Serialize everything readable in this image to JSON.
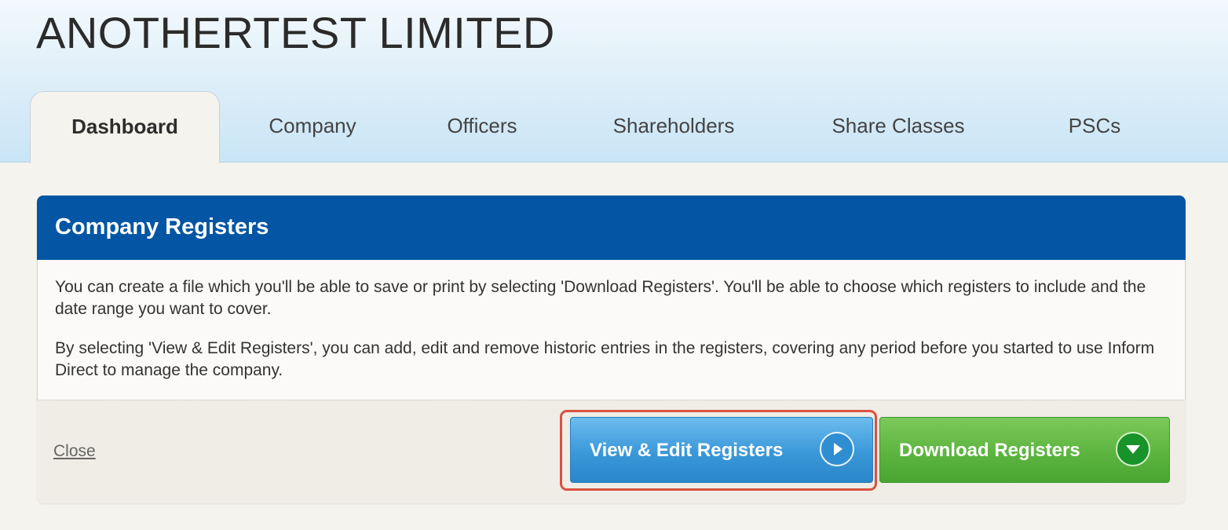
{
  "company": {
    "name": "ANOTHERTEST LIMITED"
  },
  "tabs": [
    {
      "label": "Dashboard",
      "active": true
    },
    {
      "label": "Company",
      "active": false
    },
    {
      "label": "Officers",
      "active": false
    },
    {
      "label": "Shareholders",
      "active": false
    },
    {
      "label": "Share Classes",
      "active": false
    },
    {
      "label": "PSCs",
      "active": false
    }
  ],
  "panel": {
    "title": "Company Registers",
    "paragraphs": [
      "You can create a file which you'll be able to save or print by selecting 'Download Registers'. You'll be able to choose which registers to include and the date range you want to cover.",
      "By selecting 'View & Edit Registers', you can add, edit and remove historic entries in the registers, covering any period before you started to use Inform Direct to manage the company."
    ],
    "close_label": "Close",
    "buttons": {
      "view_edit": {
        "label": "View & Edit Registers",
        "icon": "play-circle-icon",
        "color": "#3a98d9"
      },
      "download": {
        "label": "Download Registers",
        "icon": "chevron-down-circle-icon",
        "color": "#5ab33d"
      }
    }
  },
  "colors": {
    "panel_header": "#0456a4",
    "highlight_border": "#d9523f"
  }
}
